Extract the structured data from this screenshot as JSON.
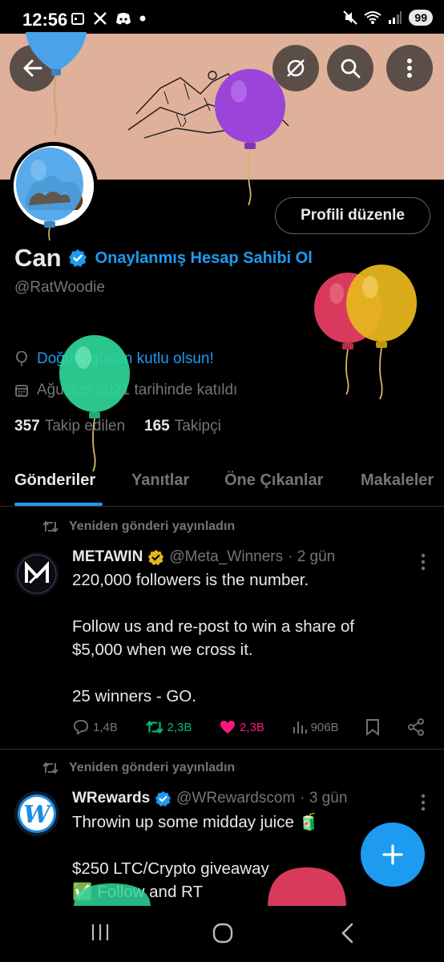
{
  "status": {
    "time": "12:56",
    "battery": "99"
  },
  "profile": {
    "name": "Can",
    "verify_link": "Onaylanmış Hesap Sahibi Ol",
    "handle": "@RatWoodie",
    "birthday": "Doğum günün kutlu olsun!",
    "joined": "Ağustos 2021 tarihinde katıldı",
    "following_count": "357",
    "following_label": "Takip edilen",
    "followers_count": "165",
    "followers_label": "Takipçi",
    "edit_button": "Profili düzenle"
  },
  "tabs": [
    {
      "label": "Gönderiler"
    },
    {
      "label": "Yanıtlar"
    },
    {
      "label": "Öne Çıkanlar"
    },
    {
      "label": "Makaleler"
    }
  ],
  "posts": [
    {
      "repost_label": "Yeniden gönderi yayınladın",
      "name": "METAWIN",
      "handle": "@Meta_Winners",
      "time": "· 2 gün",
      "text": "220,000 followers is the number.\n\nFollow us and re-post to win a share of $5,000 when we cross it.\n\n25 winners - GO.",
      "replies": "1,4B",
      "reposts": "2,3B",
      "likes": "2,3B",
      "views": "906B"
    },
    {
      "repost_label": "Yeniden gönderi yayınladın",
      "name": "WRewards",
      "handle": "@WRewardscom",
      "time": "· 3 gün",
      "text": "Throwin up some midday juice 🧃\n\n$250 LTC/Crypto giveaway\n✅ Follow and RT"
    }
  ],
  "colors": {
    "accent": "#1d9bf0",
    "banner": "#dfb09a",
    "repost_green": "#00ba7c",
    "like_pink": "#f91880",
    "muted": "#71767b"
  },
  "icons": [
    "back-arrow-icon",
    "mute-icon",
    "search-icon",
    "more-vertical-icon",
    "verified-badge-icon",
    "balloon-icon",
    "location-icon",
    "calendar-icon",
    "repost-icon",
    "reply-icon",
    "like-icon",
    "views-icon",
    "bookmark-icon",
    "share-icon",
    "compose-plus-icon"
  ]
}
